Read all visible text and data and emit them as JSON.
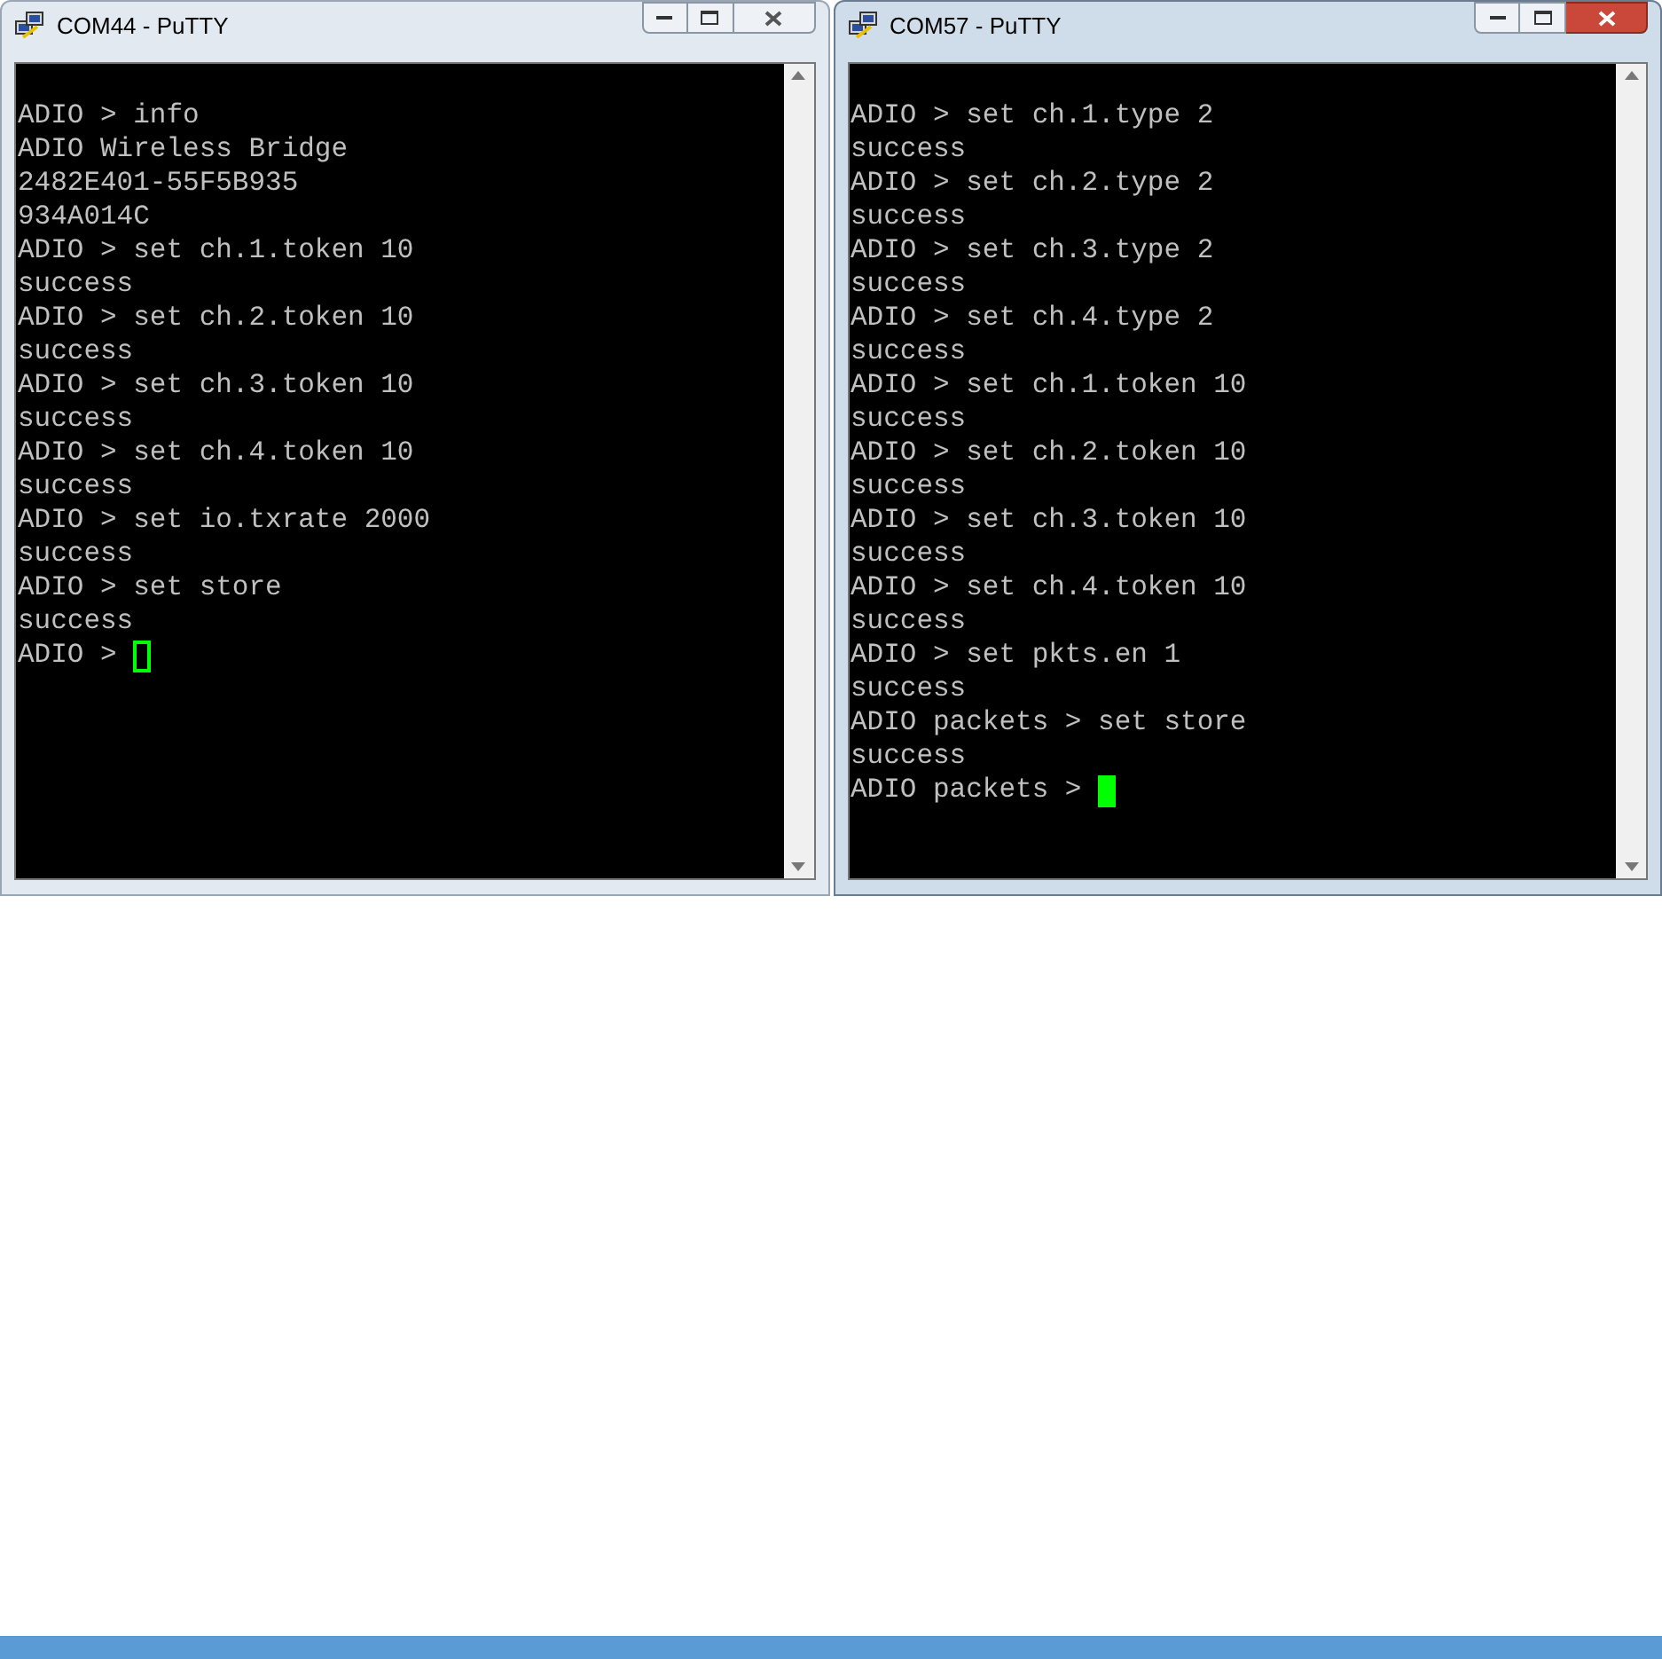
{
  "windows": [
    {
      "title": "COM44 - PuTTY",
      "active": false,
      "lines": [
        "ADIO > info",
        "ADIO Wireless Bridge",
        "2482E401-55F5B935",
        "934A014C",
        "ADIO > set ch.1.token 10",
        "success",
        "ADIO > set ch.2.token 10",
        "success",
        "ADIO > set ch.3.token 10",
        "success",
        "ADIO > set ch.4.token 10",
        "success",
        "ADIO > set io.txrate 2000",
        "success",
        "ADIO > set store",
        "success"
      ],
      "prompt": "ADIO >"
    },
    {
      "title": "COM57 - PuTTY",
      "active": true,
      "lines": [
        "ADIO > set ch.1.type 2",
        "success",
        "ADIO > set ch.2.type 2",
        "success",
        "ADIO > set ch.3.type 2",
        "success",
        "ADIO > set ch.4.type 2",
        "success",
        "ADIO > set ch.1.token 10",
        "success",
        "ADIO > set ch.2.token 10",
        "success",
        "ADIO > set ch.3.token 10",
        "success",
        "ADIO > set ch.4.token 10",
        "success",
        "ADIO > set pkts.en 1",
        "success",
        "ADIO packets > set store",
        "success"
      ],
      "prompt": "ADIO packets >"
    }
  ]
}
